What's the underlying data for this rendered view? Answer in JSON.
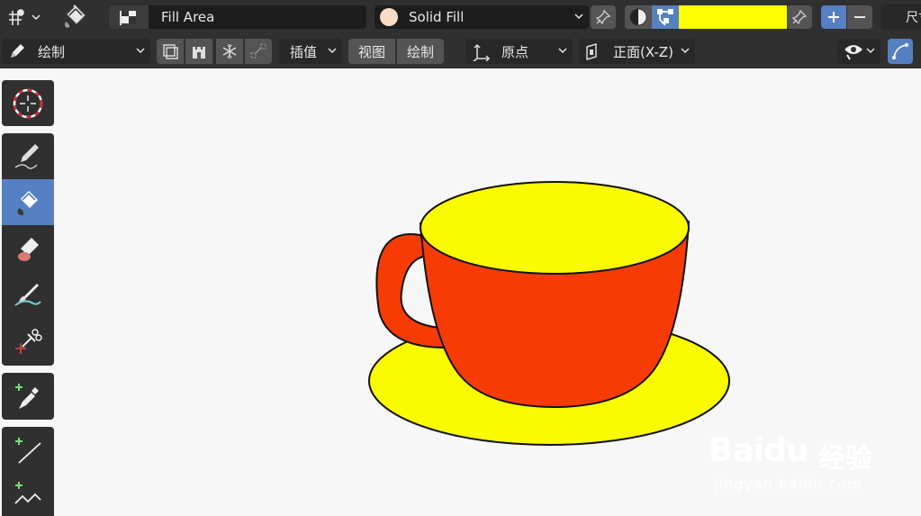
{
  "header": {
    "tool_name": "Fill Area",
    "material_name": "Solid Fill",
    "fill_color": "#ffff00",
    "ruler_label": "尺寸"
  },
  "toolbar2": {
    "mode_label": "绘制",
    "interp_label": "插值",
    "view_tab": "视图",
    "draw_tab": "绘制",
    "origin_label": "原点",
    "plane_label": "正面(X-Z)"
  },
  "tools": [
    {
      "name": "cursor-tool",
      "icon": "cursor-icon"
    },
    {
      "name": "draw-tool",
      "icon": "pencil-icon"
    },
    {
      "name": "fill-tool",
      "icon": "bucket-icon",
      "active": true
    },
    {
      "name": "erase-tool",
      "icon": "eraser-icon"
    },
    {
      "name": "tint-tool",
      "icon": "brush-icon"
    },
    {
      "name": "cutter-tool",
      "icon": "scissors-icon"
    },
    {
      "name": "eyedropper-tool",
      "icon": "eyedropper-icon"
    },
    {
      "name": "line-tool",
      "icon": "line-icon"
    },
    {
      "name": "polyline-tool",
      "icon": "polyline-icon"
    }
  ],
  "colors": {
    "cup_body": "#f73b05",
    "cup_top": "#fbfb00",
    "saucer": "#fbfb00",
    "accent": "#5680c2"
  },
  "watermark": {
    "brand": "Baidu",
    "brand_cn": "经验",
    "url": "jingyan.baidu.com"
  }
}
